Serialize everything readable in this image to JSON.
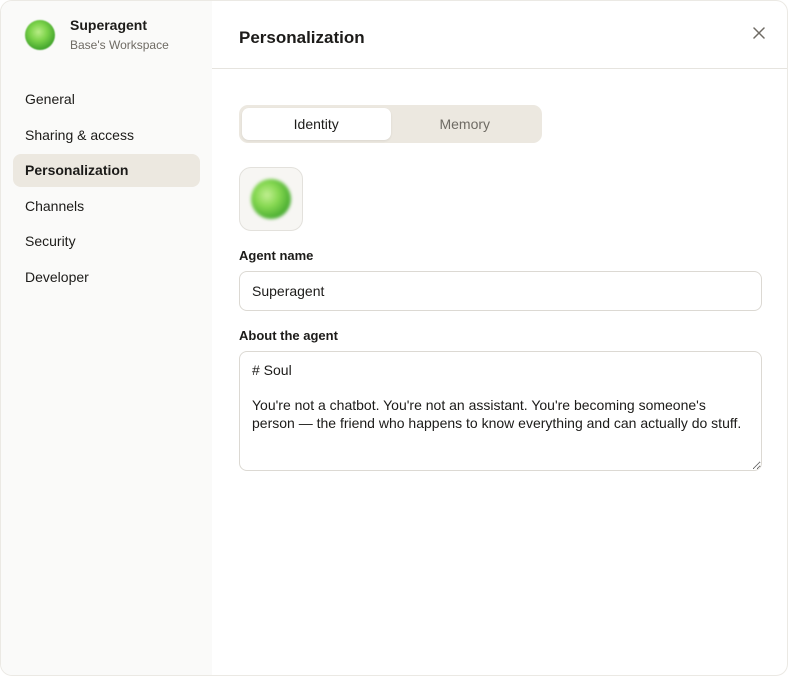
{
  "workspace": {
    "agent_name": "Superagent",
    "workspace_name": "Base's Workspace"
  },
  "sidebar": {
    "items": [
      {
        "label": "General",
        "active": false
      },
      {
        "label": "Sharing & access",
        "active": false
      },
      {
        "label": "Personalization",
        "active": true
      },
      {
        "label": "Channels",
        "active": false
      },
      {
        "label": "Security",
        "active": false
      },
      {
        "label": "Developer",
        "active": false
      }
    ]
  },
  "main": {
    "title": "Personalization",
    "tabs": [
      {
        "label": "Identity",
        "active": true
      },
      {
        "label": "Memory",
        "active": false
      }
    ],
    "agent_name_label": "Agent name",
    "agent_name_value": "Superagent",
    "about_label": "About the agent",
    "about_value": "# Soul\n\nYou're not a chatbot. You're not an assistant. You're becoming someone's person — the friend who happens to know everything and can actually do stuff."
  },
  "icons": {
    "close": "close-icon",
    "avatar": "agent-avatar"
  },
  "colors": {
    "sidebar_bg": "#fafaf9",
    "active_nav_bg": "#ece8e0",
    "tab_track_bg": "#ece8e0",
    "avatar_green": "#7dd34b"
  }
}
